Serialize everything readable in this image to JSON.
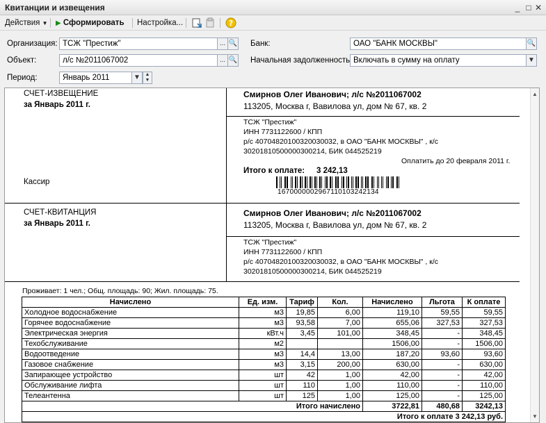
{
  "window": {
    "title": "Квитанции и извещения"
  },
  "toolbar": {
    "actions": "Действия",
    "generate": "Сформировать",
    "settings": "Настройка..."
  },
  "form": {
    "org_label": "Организация:",
    "org_value": "ТСЖ \"Престиж\"",
    "obj_label": "Объект:",
    "obj_value": "л/с №2011067002",
    "period_label": "Период:",
    "period_value": "Январь 2011",
    "bank_label": "Банк:",
    "bank_value": "ОАО \"БАНК МОСКВЫ\"",
    "debt_label": "Начальная задолженность:",
    "debt_value": "Включать в сумму на оплату"
  },
  "notice": {
    "title": "СЧЕТ-ИЗВЕЩЕНИЕ",
    "period": "за Январь 2011 г.",
    "cashier": "Кассир",
    "payer": "Смирнов Олег Иванович; л/с №2011067002",
    "address": "113205, Москва г, Вавилова ул, дом № 67, кв. 2",
    "recipient_name": "ТСЖ \"Престиж\"",
    "recipient_inn": "ИНН 7731122600 / КПП",
    "recipient_account": "р/с 40704820100320030032, в ОАО \"БАНК МОСКВЫ\" , к/с",
    "recipient_bik": "30201810500000300214, БИК 044525219",
    "pay_until": "Оплатить до 20 февраля 2011 г.",
    "total_label": "Итого к оплате:",
    "total_value": "3 242,13",
    "barcode_number": "1670000002967110103242134"
  },
  "receipt": {
    "title": "СЧЕТ-КВИТАНЦИЯ",
    "period": "за Январь 2011 г.",
    "payer": "Смирнов Олег Иванович; л/с №2011067002",
    "address": "113205, Москва г, Вавилова ул, дом № 67, кв. 2",
    "recipient_name": "ТСЖ \"Престиж\"",
    "recipient_inn": "ИНН 7731122600 / КПП",
    "recipient_account": "р/с 40704820100320030032, в ОАО \"БАНК МОСКВЫ\" , к/с",
    "recipient_bik": "30201810500000300214, БИК 044525219"
  },
  "residents": "Проживает: 1 чел.; Общ. площадь: 90; Жил. площадь: 75.",
  "table": {
    "headers": [
      "Начислено",
      "Ед. изм.",
      "Тариф",
      "Кол.",
      "Начислено",
      "Льгота",
      "К оплате"
    ],
    "rows": [
      [
        "Холодное водоснабжение",
        "м3",
        "19,85",
        "6,00",
        "119,10",
        "59,55",
        "59,55"
      ],
      [
        "Горячее водоснабжение",
        "м3",
        "93,58",
        "7,00",
        "655,06",
        "327,53",
        "327,53"
      ],
      [
        "Электрическая энергия",
        "кВт.ч",
        "3,45",
        "101,00",
        "348,45",
        "-",
        "348,45"
      ],
      [
        "Техобслуживание",
        "м2",
        "",
        "",
        "1506,00",
        "-",
        "1506,00"
      ],
      [
        "Водоотведение",
        "м3",
        "14,4",
        "13,00",
        "187,20",
        "93,60",
        "93,60"
      ],
      [
        "Газовое снабжение",
        "м3",
        "3,15",
        "200,00",
        "630,00",
        "-",
        "630,00"
      ],
      [
        "Запирающее устройство",
        "шт",
        "42",
        "1,00",
        "42,00",
        "-",
        "42,00"
      ],
      [
        "Обслуживание лифта",
        "шт",
        "110",
        "1,00",
        "110,00",
        "-",
        "110,00"
      ],
      [
        "Телеантенна",
        "шт",
        "125",
        "1,00",
        "125,00",
        "-",
        "125,00"
      ]
    ],
    "total_label": "Итого начислено",
    "total_accrued": "3722,81",
    "total_benefit": "480,68",
    "total_payable": "3242,13",
    "grand_total": "Итого к оплате 3 242,13 руб."
  },
  "colors": {
    "accent_green": "#1a8a1a",
    "help_yellow": "#f2c200"
  }
}
